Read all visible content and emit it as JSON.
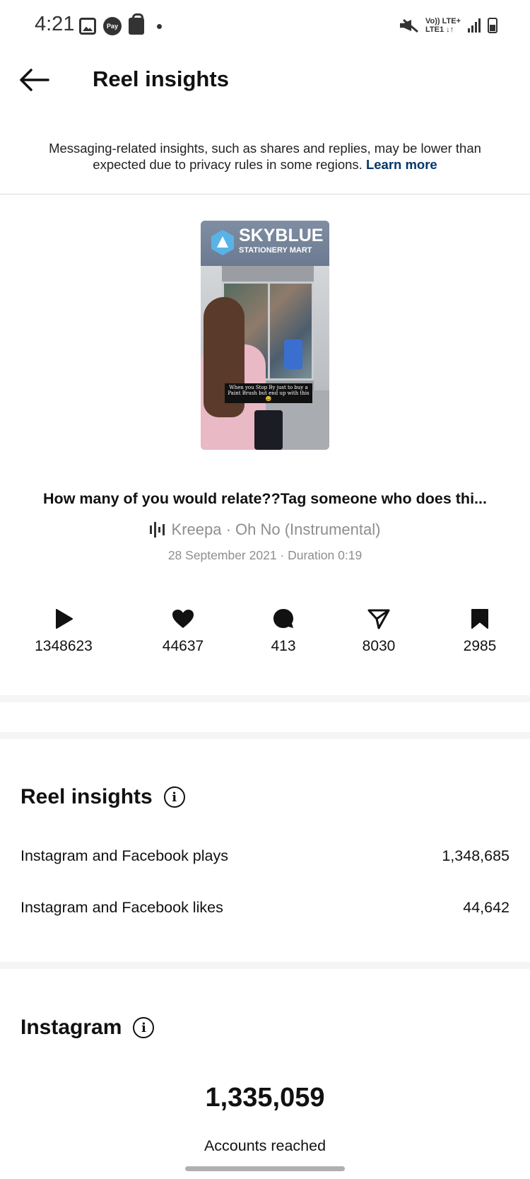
{
  "status_bar": {
    "time": "4:21",
    "pay_label": "Pay",
    "network_top": "Vo)) LTE+",
    "network_bottom": "LTE1 ↓↑"
  },
  "header": {
    "title": "Reel insights",
    "back_icon": "arrow-left-icon"
  },
  "notice": {
    "text": "Messaging-related insights, such as shares and replies, may be lower than expected due to privacy rules in some regions.",
    "link": "Learn more"
  },
  "thumbnail": {
    "brand": "SKYBLUE",
    "brand_sub": "STATIONERY MART",
    "overlay_caption": "When you Stop By just to buy a Paint Brush but end up with this😅"
  },
  "reel": {
    "caption": "How many of you would relate??Tag someone who does thi...",
    "music": "Kreepa · Oh No (Instrumental)",
    "date_duration": "28 September 2021 · Duration 0:19"
  },
  "stats": [
    {
      "icon": "play-icon",
      "value": "1348623"
    },
    {
      "icon": "heart-icon",
      "value": "44637"
    },
    {
      "icon": "comment-icon",
      "value": "413"
    },
    {
      "icon": "share-icon",
      "value": "8030"
    },
    {
      "icon": "bookmark-icon",
      "value": "2985"
    }
  ],
  "reel_insights": {
    "title": "Reel insights",
    "rows": [
      {
        "label": "Instagram and Facebook plays",
        "value": "1,348,685"
      },
      {
        "label": "Instagram and Facebook likes",
        "value": "44,642"
      }
    ]
  },
  "instagram": {
    "title": "Instagram",
    "accounts_reached": "1,335,059",
    "accounts_reached_label": "Accounts reached"
  },
  "info_glyph": "i"
}
